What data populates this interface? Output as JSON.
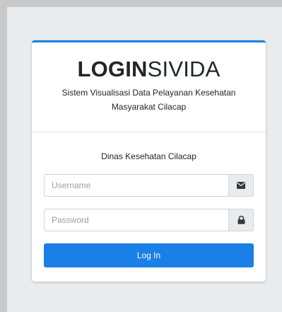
{
  "brand": {
    "bold": "LOGIN",
    "light": "SIVIDA",
    "subtitle": "Sistem Visualisasi Data Pelayanan Kesehatan Masyarakat Cilacap"
  },
  "form": {
    "message": "Dinas Kesehatan Cilacap",
    "username": {
      "placeholder": "Username",
      "value": "",
      "icon": "envelope-icon"
    },
    "password": {
      "placeholder": "Password",
      "value": "",
      "icon": "lock-icon"
    },
    "submit_label": "Log In"
  },
  "colors": {
    "primary": "#1a7fe6",
    "background": "#e9ecef",
    "frame": "#c9c9c9"
  }
}
